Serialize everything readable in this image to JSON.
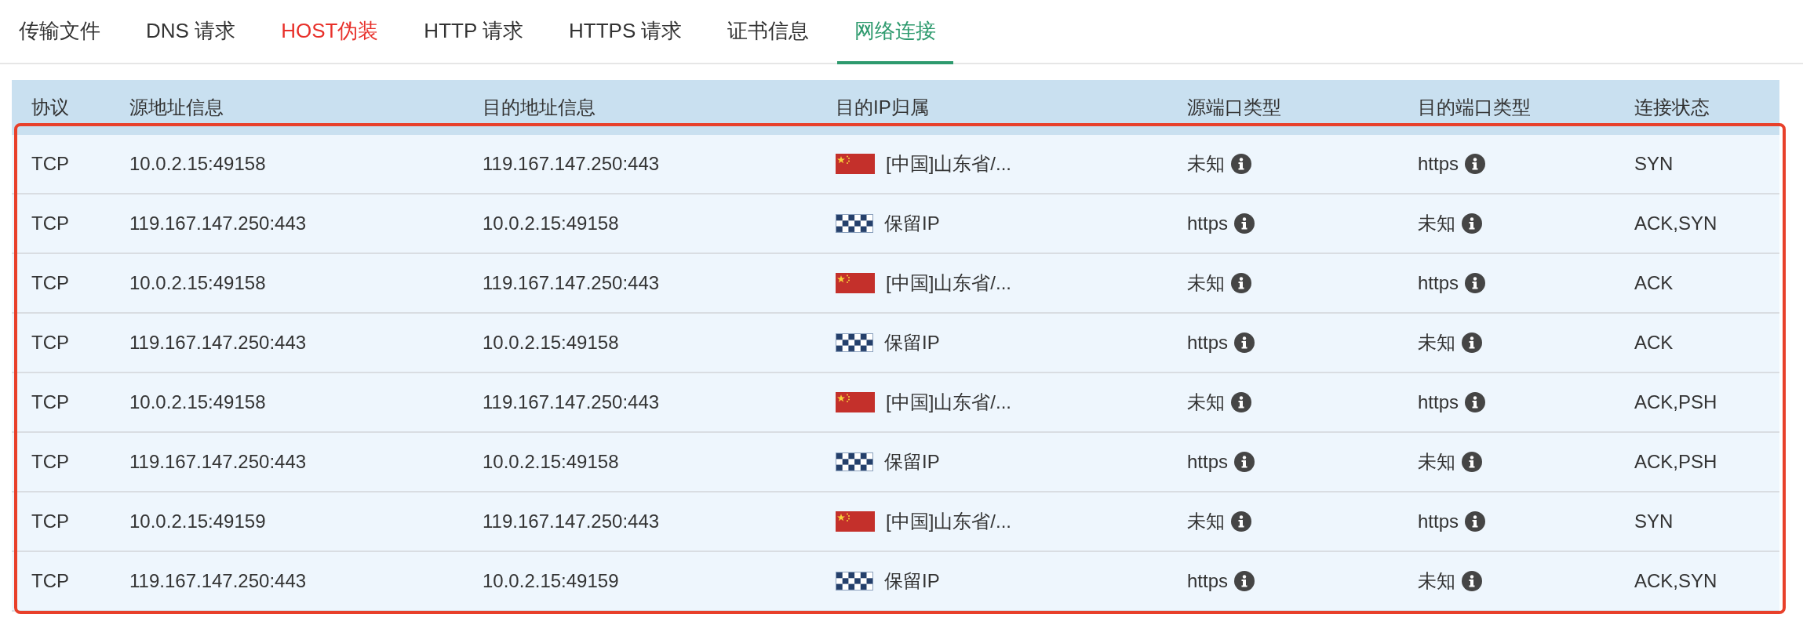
{
  "tabs": [
    {
      "label": "传输文件",
      "selected": false,
      "warning": false
    },
    {
      "label": "DNS 请求",
      "selected": false,
      "warning": false
    },
    {
      "label": "HOST伪装",
      "selected": false,
      "warning": true
    },
    {
      "label": "HTTP 请求",
      "selected": false,
      "warning": false
    },
    {
      "label": "HTTPS 请求",
      "selected": false,
      "warning": false
    },
    {
      "label": "证书信息",
      "selected": false,
      "warning": false
    },
    {
      "label": "网络连接",
      "selected": true,
      "warning": false
    }
  ],
  "table": {
    "columns": [
      "协议",
      "源地址信息",
      "目的地址信息",
      "目的IP归属",
      "源端口类型",
      "目的端口类型",
      "连接状态"
    ],
    "highlighted": true,
    "rows": [
      {
        "protocol": "TCP",
        "source": "10.0.2.15:49158",
        "destination": "119.167.147.250:443",
        "location": {
          "kind": "cn",
          "text": "[中国]山东省/..."
        },
        "source_port": "未知",
        "destination_port": "https",
        "state": "SYN"
      },
      {
        "protocol": "TCP",
        "source": "119.167.147.250:443",
        "destination": "10.0.2.15:49158",
        "location": {
          "kind": "reserved",
          "text": "保留IP"
        },
        "source_port": "https",
        "destination_port": "未知",
        "state": "ACK,SYN"
      },
      {
        "protocol": "TCP",
        "source": "10.0.2.15:49158",
        "destination": "119.167.147.250:443",
        "location": {
          "kind": "cn",
          "text": "[中国]山东省/..."
        },
        "source_port": "未知",
        "destination_port": "https",
        "state": "ACK"
      },
      {
        "protocol": "TCP",
        "source": "119.167.147.250:443",
        "destination": "10.0.2.15:49158",
        "location": {
          "kind": "reserved",
          "text": "保留IP"
        },
        "source_port": "https",
        "destination_port": "未知",
        "state": "ACK"
      },
      {
        "protocol": "TCP",
        "source": "10.0.2.15:49158",
        "destination": "119.167.147.250:443",
        "location": {
          "kind": "cn",
          "text": "[中国]山东省/..."
        },
        "source_port": "未知",
        "destination_port": "https",
        "state": "ACK,PSH"
      },
      {
        "protocol": "TCP",
        "source": "119.167.147.250:443",
        "destination": "10.0.2.15:49158",
        "location": {
          "kind": "reserved",
          "text": "保留IP"
        },
        "source_port": "https",
        "destination_port": "未知",
        "state": "ACK,PSH"
      },
      {
        "protocol": "TCP",
        "source": "10.0.2.15:49159",
        "destination": "119.167.147.250:443",
        "location": {
          "kind": "cn",
          "text": "[中国]山东省/..."
        },
        "source_port": "未知",
        "destination_port": "https",
        "state": "SYN"
      },
      {
        "protocol": "TCP",
        "source": "119.167.147.250:443",
        "destination": "10.0.2.15:49159",
        "location": {
          "kind": "reserved",
          "text": "保留IP"
        },
        "source_port": "https",
        "destination_port": "未知",
        "state": "ACK,SYN"
      }
    ]
  }
}
